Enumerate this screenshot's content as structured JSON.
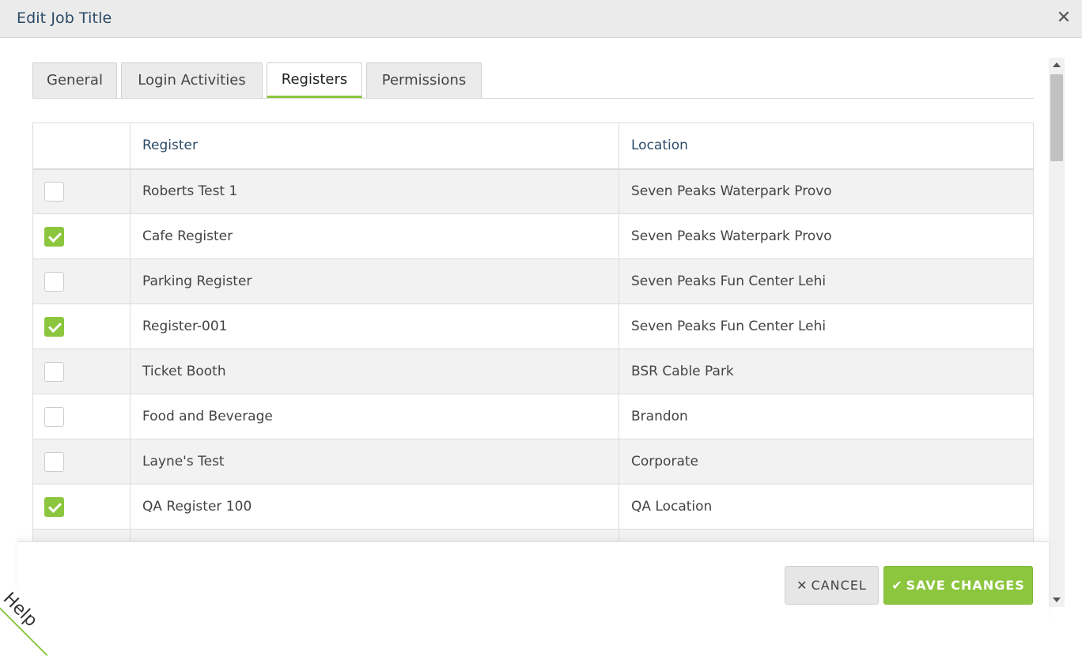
{
  "modal": {
    "title": "Edit Job Title",
    "close_glyph": "✕"
  },
  "tabs": [
    {
      "label": "General",
      "active": false
    },
    {
      "label": "Login Activities",
      "active": false
    },
    {
      "label": "Registers",
      "active": true
    },
    {
      "label": "Permissions",
      "active": false
    }
  ],
  "table": {
    "headers": {
      "check": "",
      "register": "Register",
      "location": "Location"
    },
    "rows": [
      {
        "checked": false,
        "register": "Roberts Test 1",
        "location": "Seven Peaks Waterpark Provo"
      },
      {
        "checked": true,
        "register": "Cafe Register",
        "location": "Seven Peaks Waterpark Provo"
      },
      {
        "checked": false,
        "register": "Parking Register",
        "location": "Seven Peaks Fun Center Lehi"
      },
      {
        "checked": true,
        "register": "Register-001",
        "location": "Seven Peaks Fun Center Lehi"
      },
      {
        "checked": false,
        "register": "Ticket Booth",
        "location": "BSR Cable Park"
      },
      {
        "checked": false,
        "register": "Food and Beverage",
        "location": "Brandon"
      },
      {
        "checked": false,
        "register": "Layne's Test",
        "location": "Corporate"
      },
      {
        "checked": true,
        "register": "QA Register 100",
        "location": "QA Location"
      },
      {
        "checked": false,
        "register": "",
        "location": ""
      }
    ]
  },
  "footer": {
    "cancel_label": "CANCEL",
    "cancel_icon": "✕",
    "save_label": "SAVE CHANGES",
    "save_icon": "✔"
  },
  "help_ribbon": {
    "label": "Help"
  },
  "colors": {
    "accent": "#8cc63f",
    "title": "#2c4a66",
    "header_bg": "#ebebeb"
  }
}
